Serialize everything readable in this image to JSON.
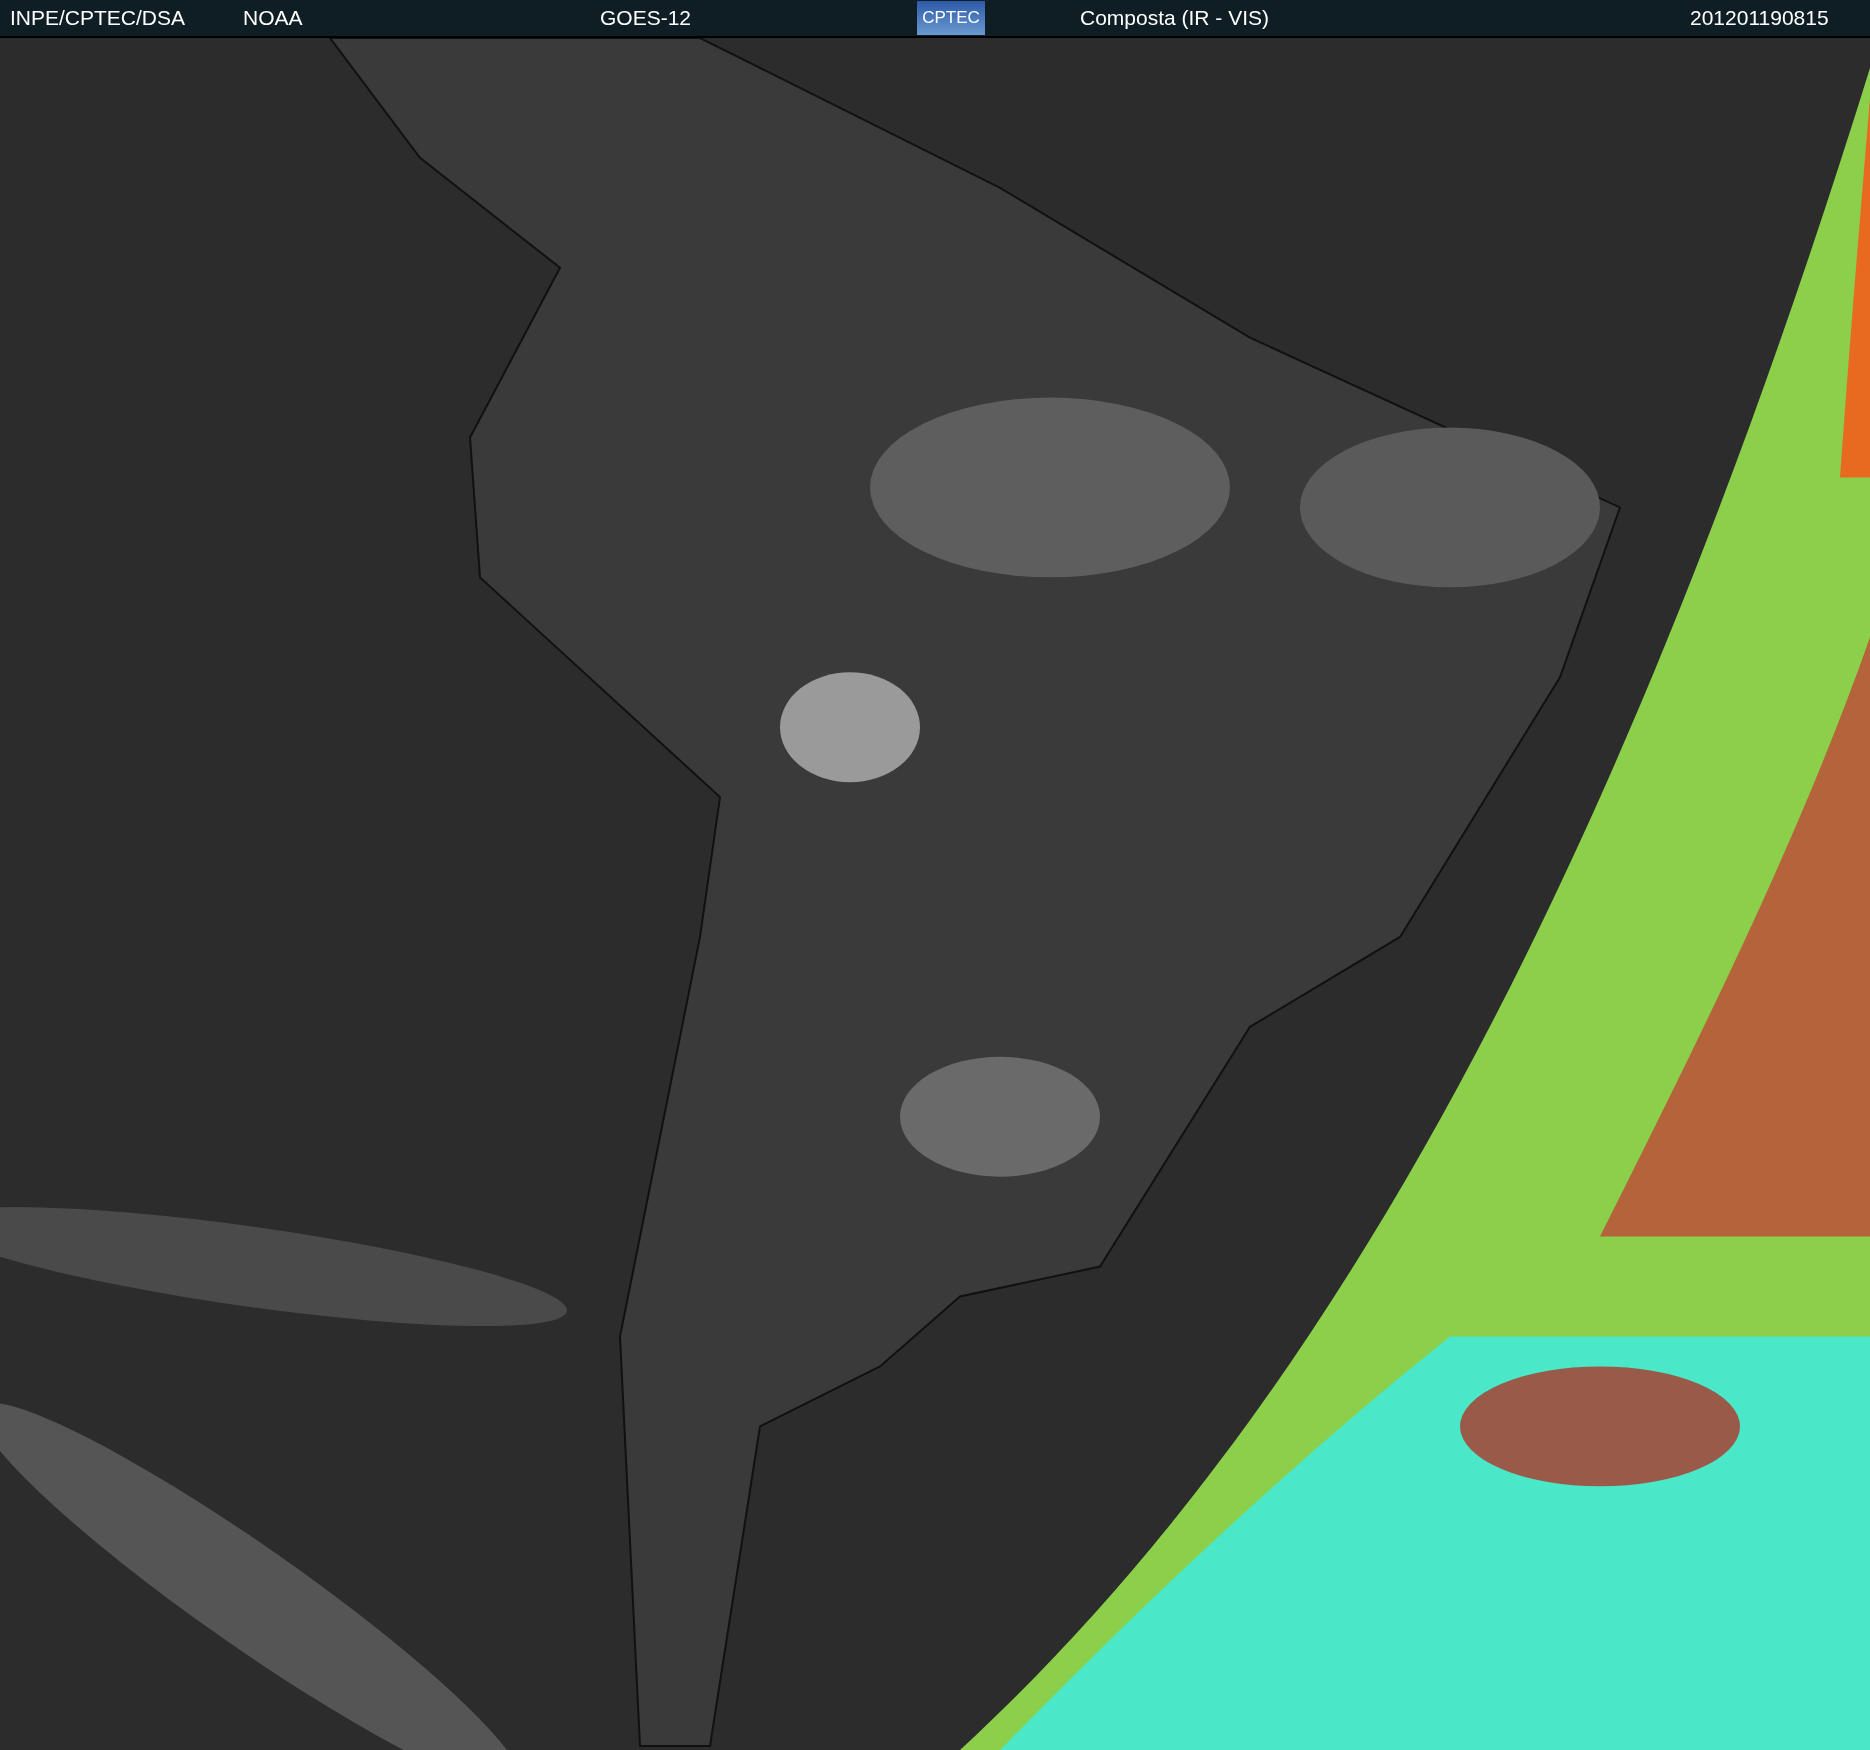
{
  "header": {
    "source": "INPE/CPTEC/DSA",
    "agency": "NOAA",
    "satellite": "GOES-12",
    "logo": "CPTEC",
    "product": "Composta (IR - VIS)",
    "timestamp": "201201190815"
  }
}
